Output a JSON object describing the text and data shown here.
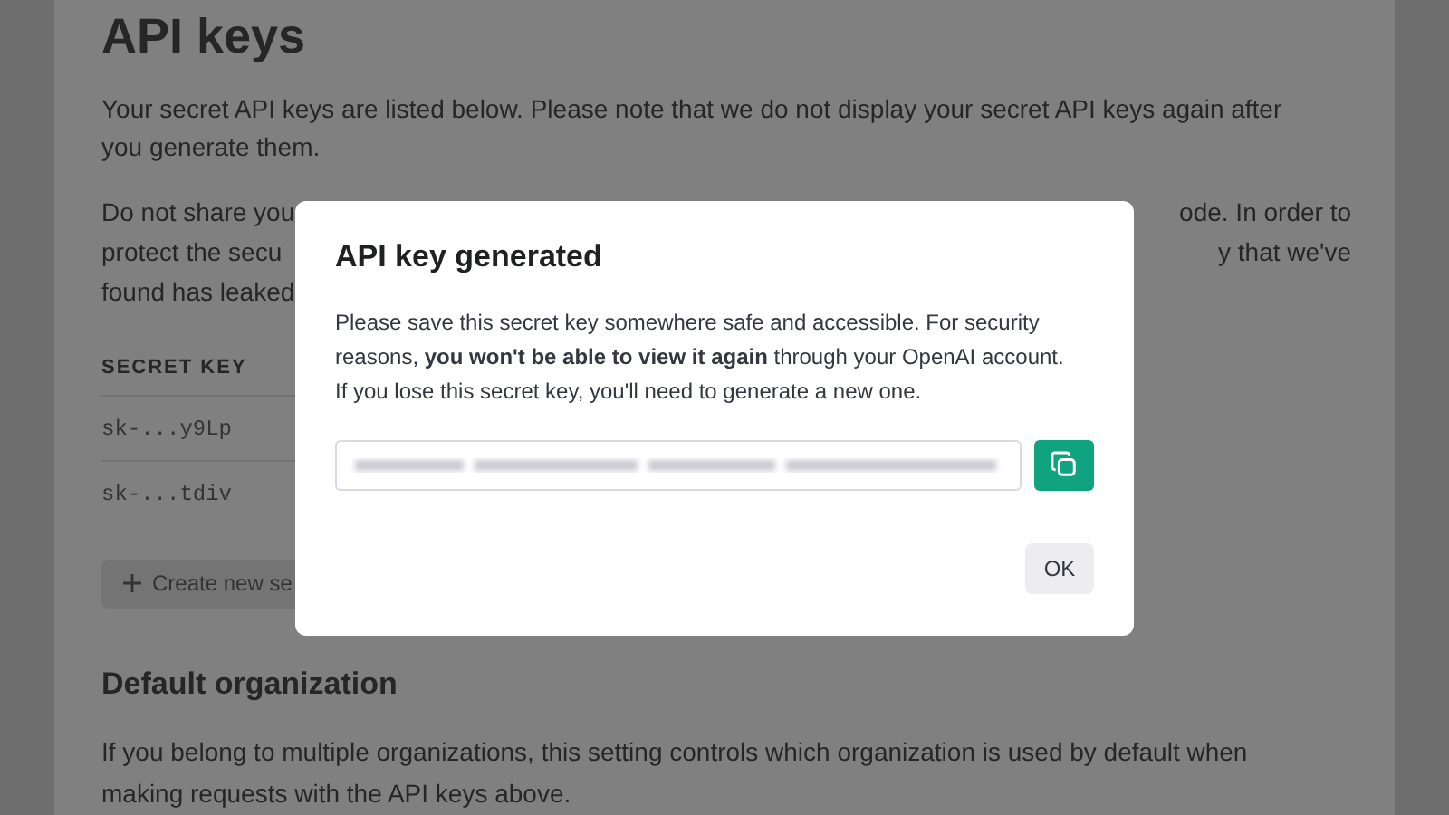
{
  "page": {
    "title": "API keys",
    "intro": "Your secret API keys are listed below. Please note that we do not display your secret API keys again after you generate them.",
    "warning_lines": [
      {
        "left": "Do not share you",
        "right": "ode. In order to"
      },
      {
        "left": "protect the secu",
        "right": "y that we've"
      },
      {
        "left": "found has leaked"
      }
    ],
    "table": {
      "column": "SECRET KEY",
      "rows": [
        "sk-...y9Lp",
        "sk-...tdiv"
      ]
    },
    "create_button": "Create new se",
    "section_title": "Default organization",
    "section_text": "If you belong to multiple organizations, this setting controls which organization is used by default when making requests with the API keys above."
  },
  "dialog": {
    "title": "API key generated",
    "message": "Please save this secret key somewhere safe and accessible. For security reasons, **you won't be able to view it again** through your OpenAI account. If you lose this secret key, you'll need to generate a new one.",
    "ok_button": "OK"
  }
}
